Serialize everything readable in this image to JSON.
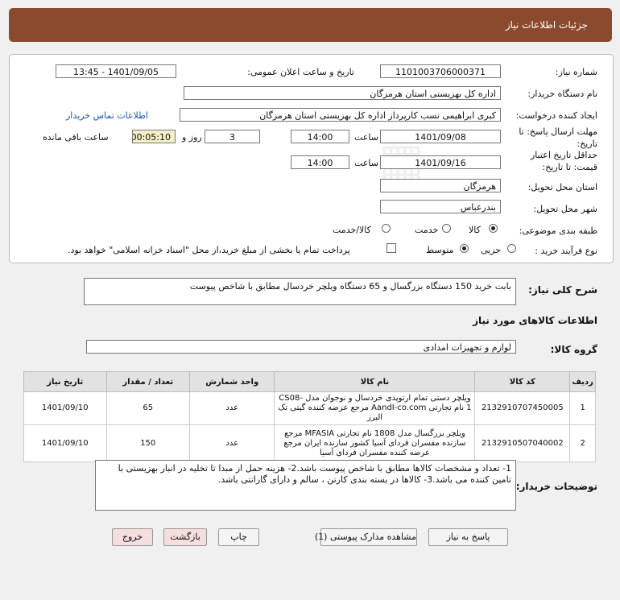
{
  "page_title": "جزئیات اطلاعات نیاز",
  "fields": {
    "need_number_label": "شماره نیاز:",
    "need_number": "1101003706000371",
    "announce_label": "تاریخ و ساعت اعلان عمومی:",
    "announce_value": "1401/09/05 - 13:45",
    "buyer_org_label": "نام دستگاه خریدار:",
    "buyer_org": "اداره کل بهزیستی استان هرمزگان",
    "requester_label": "ایجاد کننده درخواست:",
    "requester": "کبری  ابراهیمی نسب کارپرداز اداره کل بهزیستی استان هرمزگان",
    "contact_link": "اطلاعات تماس خریدار",
    "deadline_label_1": "مهلت ارسال پاسخ: تا",
    "deadline_label_2": "تاریخ:",
    "deadline_date": "1401/09/08",
    "time_label": "ساعت",
    "deadline_time": "14:00",
    "days_count": "3",
    "days_label": "روز و",
    "remaining_time": "00:05:10",
    "remaining_label": "ساعت باقی مانده",
    "validity_label_1": "حداقل تاریخ اعتبار",
    "validity_label_2": "قیمت: تا تاریخ:",
    "validity_date": "1401/09/16",
    "validity_time": "14:00",
    "province_label": "استان محل تحویل:",
    "province": "هرمزگان",
    "city_label": "شهر محل تحویل:",
    "city": "بندرعباس",
    "category_label": "طبقه بندی موضوعی:",
    "category_options": [
      "کالا",
      "خدمت",
      "کالا/خدمت"
    ],
    "process_label": "نوع فرآیند خرید :",
    "process_options": [
      "جزیی",
      "متوسط"
    ],
    "treasury_note": "پرداخت تمام یا بخشی از مبلغ خرید،از محل \"اسناد خزانه اسلامی\" خواهد بود."
  },
  "summary": {
    "label": "شرح کلی نیاز:",
    "text": "بابت خرید 150 دستگاه بزرگسال و 65 دستگاه ویلچر خردسال مطابق با شاخص پیوست"
  },
  "goods_info_title": "اطلاعات کالاهای مورد نیاز",
  "goods_group": {
    "label": "گروه کالا:",
    "value": "لوازم و تجهیزات امدادی"
  },
  "table": {
    "headers": [
      "ردیف",
      "کد کالا",
      "نام کالا",
      "واحد شمارش",
      "تعداد / مقدار",
      "تاریخ نیاز"
    ],
    "rows": [
      {
        "row": "1",
        "code": "2132910707450005",
        "name": "ویلچر دستی تمام ارتوپدی خردسال و نوجوان مدل CS08-1 نام تجارتی AandI-co.com مرجع عرضه کننده گیتی تک البرز",
        "unit": "عدد",
        "qty": "65",
        "date": "1401/09/10"
      },
      {
        "row": "2",
        "code": "2132910507040002",
        "name": "ویلچر بزرگسال مدل 1808 نام تجارتی MFASIA مرجع سازنده مفسران فردای آسیا کشور سازنده ایران مرجع عرضه کننده مفسران فردای آسیا",
        "unit": "عدد",
        "qty": "150",
        "date": "1401/09/10"
      }
    ]
  },
  "buyer_notes": {
    "label": "توضیحات خریدار:",
    "text": "1- تعداد و مشخصات کالاها مطابق با شاخص پیوست باشد.2- هزینه حمل از مبدا تا تخلیه در انبار بهزیستی با تامین کننده می باشد.3- کالاها در بسته بندی کارتن ، سالم و دارای گارانتی باشد."
  },
  "buttons": {
    "reply": "پاسخ به نیاز",
    "attachments": "مشاهده مدارک پیوستی (1)",
    "print": "چاپ",
    "back": "بازگشت",
    "exit": "خروج"
  }
}
